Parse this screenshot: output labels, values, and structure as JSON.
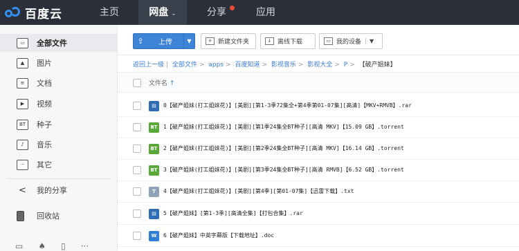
{
  "app": {
    "logo_text": "百度云"
  },
  "top_nav": [
    {
      "label": "主页"
    },
    {
      "label": "网盘",
      "active": true
    },
    {
      "label": "分享",
      "badge": true
    },
    {
      "label": "应用"
    }
  ],
  "sidebar": {
    "items": [
      {
        "label": "全部文件",
        "icon": "folder-icon",
        "active": true
      },
      {
        "label": "图片",
        "icon": "image-icon"
      },
      {
        "label": "文档",
        "icon": "document-icon"
      },
      {
        "label": "视频",
        "icon": "video-icon"
      },
      {
        "label": "种子",
        "icon": "torrent-icon",
        "glyph": "BT"
      },
      {
        "label": "音乐",
        "icon": "music-icon",
        "glyph": "♪"
      },
      {
        "label": "其它",
        "icon": "other-icon",
        "glyph": "···"
      },
      {
        "label": "我的分享",
        "icon": "share-icon"
      },
      {
        "label": "回收站",
        "icon": "trash-icon"
      }
    ]
  },
  "toolbar": {
    "upload_label": "上传",
    "new_folder_label": "新建文件夹",
    "offline_download_label": "离线下载",
    "my_devices_label": "我的设备"
  },
  "breadcrumb": {
    "back": "返回上一级",
    "items": [
      "全部文件",
      "apps",
      "百度知道",
      "影视音乐",
      "影视大全",
      "P"
    ],
    "current": "【破产姐妹】"
  },
  "list": {
    "header_label": "文件名",
    "files": [
      {
        "name": "0【破产姐妹(打工姐妹花)】[美剧][第1-3季72集全+第4季第01-07集][高清]【MKV+RMVB】.rar",
        "type": "rar",
        "color": "#2e6db4"
      },
      {
        "name": "1【破产姐妹(打工姐妹花)】[美剧][第1季24集全BT种子][高清 MKV]【15.09 GB】.torrent",
        "type": "bt",
        "color": "#5aa83c"
      },
      {
        "name": "2【破产姐妹(打工姐妹花)】[美剧][第2季24集全BT种子][高清 MKV]【16.14 GB】.torrent",
        "type": "bt",
        "color": "#5aa83c"
      },
      {
        "name": "3【破产姐妹(打工姐妹花)】[美剧][第3季24集全BT种子][高清 RMVB]【6.52 GB】.torrent",
        "type": "bt",
        "color": "#5aa83c"
      },
      {
        "name": "4【破产姐妹(打工姐妹花)】[美剧][第4季][第01-07集]【迅雷下载】.txt",
        "type": "txt",
        "color": "#8fa3b8"
      },
      {
        "name": "5【破产姐妹】[第1-3季][高清全集]【打包合集】.rar",
        "type": "rar",
        "color": "#2e6db4"
      },
      {
        "name": "6【破产姐妹】中英字幕版【下载地址】.doc",
        "type": "doc",
        "color": "#2f7fd8"
      }
    ]
  }
}
